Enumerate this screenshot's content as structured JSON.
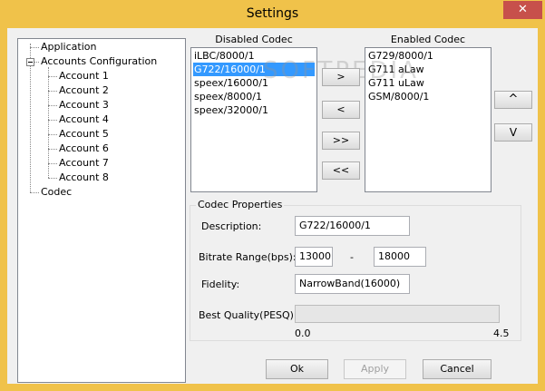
{
  "window": {
    "title": "Settings",
    "close_glyph": "✕"
  },
  "tree": {
    "items": [
      {
        "label": "Application"
      },
      {
        "label": "Accounts Configuration",
        "expanded": true
      },
      {
        "label": "Account 1"
      },
      {
        "label": "Account 2"
      },
      {
        "label": "Account 3"
      },
      {
        "label": "Account 4"
      },
      {
        "label": "Account 5"
      },
      {
        "label": "Account 6"
      },
      {
        "label": "Account 7"
      },
      {
        "label": "Account 8"
      },
      {
        "label": "Codec"
      }
    ]
  },
  "disabled_codec": {
    "title": "Disabled Codec",
    "items": [
      "iLBC/8000/1",
      "G722/16000/1",
      "speex/16000/1",
      "speex/8000/1",
      "speex/32000/1"
    ],
    "selected_index": 1
  },
  "enabled_codec": {
    "title": "Enabled Codec",
    "items": [
      "G729/8000/1",
      "G711 aLaw",
      "G711 uLaw",
      "GSM/8000/1"
    ]
  },
  "transfer_buttons": {
    "move_right": ">",
    "move_left": "<",
    "move_all_right": ">>",
    "move_all_left": "<<"
  },
  "order_buttons": {
    "up": "^",
    "down": "V"
  },
  "codec_properties": {
    "title": "Codec Properties",
    "description_label": "Description:",
    "description_value": "G722/16000/1",
    "bitrate_label": "Bitrate Range(bps):",
    "bitrate_min": "13000",
    "bitrate_separator": "-",
    "bitrate_max": "18000",
    "fidelity_label": "Fidelity:",
    "fidelity_value": "NarrowBand(16000)",
    "pesq_label": "Best Quality(PESQ):",
    "pesq_min": "0.0",
    "pesq_max": "4.5",
    "pesq_value": 0
  },
  "footer": {
    "ok": "Ok",
    "apply": "Apply",
    "cancel": "Cancel"
  },
  "watermark": "SOFTPEDIA",
  "colors": {
    "title_bar": "#f0c24a",
    "close_button": "#c7504b",
    "selection": "#3399ff"
  }
}
